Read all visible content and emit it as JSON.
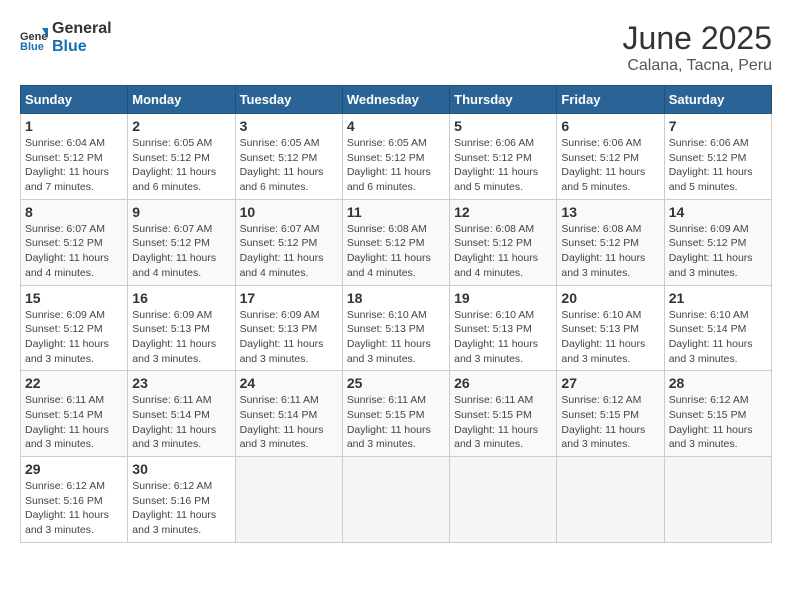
{
  "header": {
    "logo": {
      "text_general": "General",
      "text_blue": "Blue"
    },
    "title": "June 2025",
    "subtitle": "Calana, Tacna, Peru"
  },
  "calendar": {
    "weekdays": [
      "Sunday",
      "Monday",
      "Tuesday",
      "Wednesday",
      "Thursday",
      "Friday",
      "Saturday"
    ],
    "weeks": [
      [
        {
          "day": "1",
          "sunrise": "6:04 AM",
          "sunset": "5:12 PM",
          "daylight": "11 hours and 7 minutes."
        },
        {
          "day": "2",
          "sunrise": "6:05 AM",
          "sunset": "5:12 PM",
          "daylight": "11 hours and 6 minutes."
        },
        {
          "day": "3",
          "sunrise": "6:05 AM",
          "sunset": "5:12 PM",
          "daylight": "11 hours and 6 minutes."
        },
        {
          "day": "4",
          "sunrise": "6:05 AM",
          "sunset": "5:12 PM",
          "daylight": "11 hours and 6 minutes."
        },
        {
          "day": "5",
          "sunrise": "6:06 AM",
          "sunset": "5:12 PM",
          "daylight": "11 hours and 5 minutes."
        },
        {
          "day": "6",
          "sunrise": "6:06 AM",
          "sunset": "5:12 PM",
          "daylight": "11 hours and 5 minutes."
        },
        {
          "day": "7",
          "sunrise": "6:06 AM",
          "sunset": "5:12 PM",
          "daylight": "11 hours and 5 minutes."
        }
      ],
      [
        {
          "day": "8",
          "sunrise": "6:07 AM",
          "sunset": "5:12 PM",
          "daylight": "11 hours and 4 minutes."
        },
        {
          "day": "9",
          "sunrise": "6:07 AM",
          "sunset": "5:12 PM",
          "daylight": "11 hours and 4 minutes."
        },
        {
          "day": "10",
          "sunrise": "6:07 AM",
          "sunset": "5:12 PM",
          "daylight": "11 hours and 4 minutes."
        },
        {
          "day": "11",
          "sunrise": "6:08 AM",
          "sunset": "5:12 PM",
          "daylight": "11 hours and 4 minutes."
        },
        {
          "day": "12",
          "sunrise": "6:08 AM",
          "sunset": "5:12 PM",
          "daylight": "11 hours and 4 minutes."
        },
        {
          "day": "13",
          "sunrise": "6:08 AM",
          "sunset": "5:12 PM",
          "daylight": "11 hours and 3 minutes."
        },
        {
          "day": "14",
          "sunrise": "6:09 AM",
          "sunset": "5:12 PM",
          "daylight": "11 hours and 3 minutes."
        }
      ],
      [
        {
          "day": "15",
          "sunrise": "6:09 AM",
          "sunset": "5:12 PM",
          "daylight": "11 hours and 3 minutes."
        },
        {
          "day": "16",
          "sunrise": "6:09 AM",
          "sunset": "5:13 PM",
          "daylight": "11 hours and 3 minutes."
        },
        {
          "day": "17",
          "sunrise": "6:09 AM",
          "sunset": "5:13 PM",
          "daylight": "11 hours and 3 minutes."
        },
        {
          "day": "18",
          "sunrise": "6:10 AM",
          "sunset": "5:13 PM",
          "daylight": "11 hours and 3 minutes."
        },
        {
          "day": "19",
          "sunrise": "6:10 AM",
          "sunset": "5:13 PM",
          "daylight": "11 hours and 3 minutes."
        },
        {
          "day": "20",
          "sunrise": "6:10 AM",
          "sunset": "5:13 PM",
          "daylight": "11 hours and 3 minutes."
        },
        {
          "day": "21",
          "sunrise": "6:10 AM",
          "sunset": "5:14 PM",
          "daylight": "11 hours and 3 minutes."
        }
      ],
      [
        {
          "day": "22",
          "sunrise": "6:11 AM",
          "sunset": "5:14 PM",
          "daylight": "11 hours and 3 minutes."
        },
        {
          "day": "23",
          "sunrise": "6:11 AM",
          "sunset": "5:14 PM",
          "daylight": "11 hours and 3 minutes."
        },
        {
          "day": "24",
          "sunrise": "6:11 AM",
          "sunset": "5:14 PM",
          "daylight": "11 hours and 3 minutes."
        },
        {
          "day": "25",
          "sunrise": "6:11 AM",
          "sunset": "5:15 PM",
          "daylight": "11 hours and 3 minutes."
        },
        {
          "day": "26",
          "sunrise": "6:11 AM",
          "sunset": "5:15 PM",
          "daylight": "11 hours and 3 minutes."
        },
        {
          "day": "27",
          "sunrise": "6:12 AM",
          "sunset": "5:15 PM",
          "daylight": "11 hours and 3 minutes."
        },
        {
          "day": "28",
          "sunrise": "6:12 AM",
          "sunset": "5:15 PM",
          "daylight": "11 hours and 3 minutes."
        }
      ],
      [
        {
          "day": "29",
          "sunrise": "6:12 AM",
          "sunset": "5:16 PM",
          "daylight": "11 hours and 3 minutes."
        },
        {
          "day": "30",
          "sunrise": "6:12 AM",
          "sunset": "5:16 PM",
          "daylight": "11 hours and 3 minutes."
        },
        null,
        null,
        null,
        null,
        null
      ]
    ],
    "labels": {
      "sunrise": "Sunrise:",
      "sunset": "Sunset:",
      "daylight": "Daylight:"
    }
  }
}
